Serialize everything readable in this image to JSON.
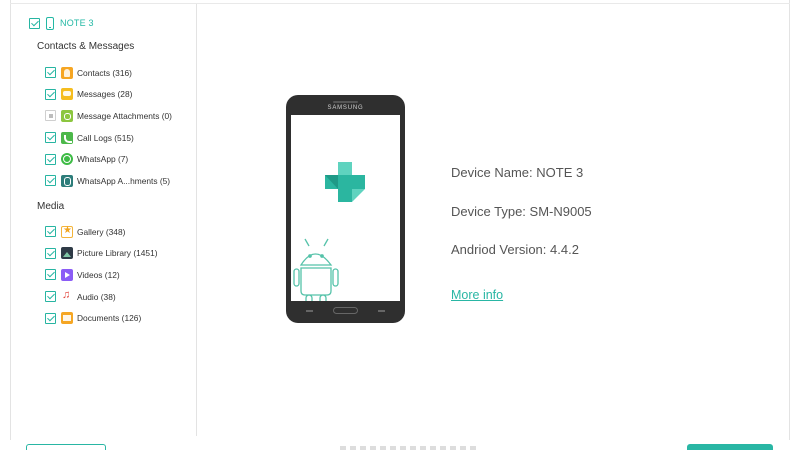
{
  "device": {
    "name": "NOTE 3",
    "checked": true
  },
  "sections": [
    {
      "title": "Contacts & Messages",
      "items": [
        {
          "label": "Contacts (316)",
          "icon": "contacts-icon",
          "state": "on"
        },
        {
          "label": "Messages (28)",
          "icon": "messages-icon",
          "state": "on"
        },
        {
          "label": "Message Attachments (0)",
          "icon": "message-attachment-icon",
          "state": "partial"
        },
        {
          "label": "Call Logs (515)",
          "icon": "call-log-icon",
          "state": "on"
        },
        {
          "label": "WhatsApp (7)",
          "icon": "whatsapp-icon",
          "state": "on"
        },
        {
          "label": "WhatsApp A...hments (5)",
          "icon": "whatsapp-attachment-icon",
          "state": "on"
        }
      ]
    },
    {
      "title": "Media",
      "items": [
        {
          "label": "Gallery (348)",
          "icon": "gallery-icon",
          "state": "on"
        },
        {
          "label": "Picture Library (1451)",
          "icon": "picture-library-icon",
          "state": "on"
        },
        {
          "label": "Videos (12)",
          "icon": "videos-icon",
          "state": "on"
        },
        {
          "label": "Audio (38)",
          "icon": "audio-icon",
          "state": "on"
        },
        {
          "label": "Documents (126)",
          "icon": "documents-icon",
          "state": "on"
        }
      ]
    }
  ],
  "phone": {
    "brand": "SAMSUNG"
  },
  "info": {
    "device_name": "Device Name: NOTE 3",
    "device_type": "Device Type: SM-N9005",
    "android_version": "Andriod Version: 4.4.2",
    "more_info": "More info"
  },
  "colors": {
    "accent": "#29b6a4",
    "text": "#555555",
    "phone_body": "#2f2f2f"
  }
}
